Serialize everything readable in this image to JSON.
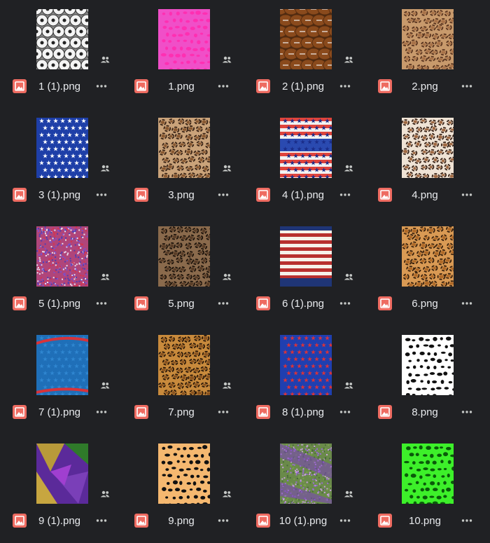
{
  "colors": {
    "background": "#202124",
    "text": "#e8eaed",
    "file_type_icon": "#ee6b61",
    "secondary_icon": "#c4c7c5"
  },
  "files": [
    {
      "name": "1 (1).png",
      "pattern": "soccer-balls",
      "shared": true
    },
    {
      "name": "1.png",
      "pattern": "pink-leopard",
      "shared": true
    },
    {
      "name": "2 (1).png",
      "pattern": "footballs",
      "shared": true
    },
    {
      "name": "2.png",
      "pattern": "tan-leopard",
      "shared": false
    },
    {
      "name": "3 (1).png",
      "pattern": "white-stars-on-blue",
      "shared": true
    },
    {
      "name": "3.png",
      "pattern": "leopard",
      "shared": true
    },
    {
      "name": "4 (1).png",
      "pattern": "patriotic-stars-stripes",
      "shared": true
    },
    {
      "name": "4.png",
      "pattern": "leopard-light",
      "shared": false
    },
    {
      "name": "5 (1).png",
      "pattern": "red-blue-glitter",
      "shared": true
    },
    {
      "name": "5.png",
      "pattern": "dark-leopard",
      "shared": true
    },
    {
      "name": "6 (1).png",
      "pattern": "stars-and-stripes",
      "shared": true
    },
    {
      "name": "6.png",
      "pattern": "orange-leopard",
      "shared": false
    },
    {
      "name": "7 (1).png",
      "pattern": "blue-stars-ribbon",
      "shared": true
    },
    {
      "name": "7.png",
      "pattern": "brown-leopard",
      "shared": true
    },
    {
      "name": "8 (1).png",
      "pattern": "flag-hearts-on-blue",
      "shared": true
    },
    {
      "name": "8.png",
      "pattern": "black-white-leopard",
      "shared": false
    },
    {
      "name": "9 (1).png",
      "pattern": "mardi-gras-foil",
      "shared": true
    },
    {
      "name": "9.png",
      "pattern": "cheetah",
      "shared": true
    },
    {
      "name": "10 (1).png",
      "pattern": "glitter-stripes",
      "shared": true
    },
    {
      "name": "10.png",
      "pattern": "neon-green-leopard",
      "shared": false
    }
  ]
}
